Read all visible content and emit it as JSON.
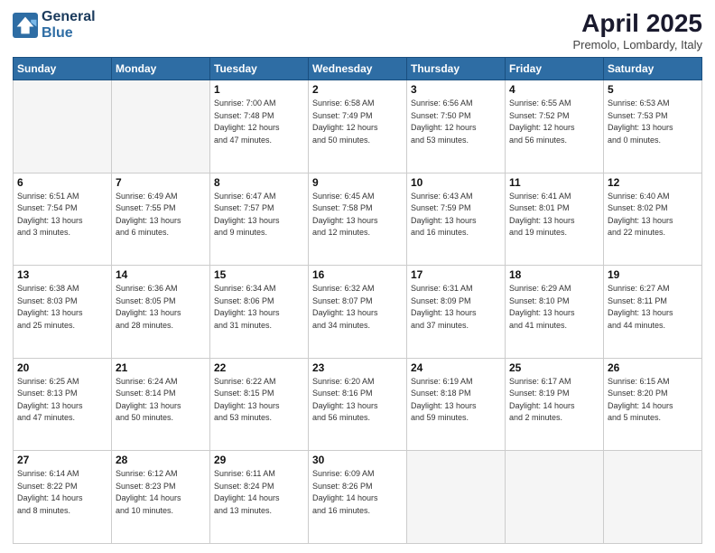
{
  "header": {
    "logo_line1": "General",
    "logo_line2": "Blue",
    "month_title": "April 2025",
    "subtitle": "Premolo, Lombardy, Italy"
  },
  "weekdays": [
    "Sunday",
    "Monday",
    "Tuesday",
    "Wednesday",
    "Thursday",
    "Friday",
    "Saturday"
  ],
  "weeks": [
    [
      {
        "day": "",
        "info": ""
      },
      {
        "day": "",
        "info": ""
      },
      {
        "day": "1",
        "info": "Sunrise: 7:00 AM\nSunset: 7:48 PM\nDaylight: 12 hours\nand 47 minutes."
      },
      {
        "day": "2",
        "info": "Sunrise: 6:58 AM\nSunset: 7:49 PM\nDaylight: 12 hours\nand 50 minutes."
      },
      {
        "day": "3",
        "info": "Sunrise: 6:56 AM\nSunset: 7:50 PM\nDaylight: 12 hours\nand 53 minutes."
      },
      {
        "day": "4",
        "info": "Sunrise: 6:55 AM\nSunset: 7:52 PM\nDaylight: 12 hours\nand 56 minutes."
      },
      {
        "day": "5",
        "info": "Sunrise: 6:53 AM\nSunset: 7:53 PM\nDaylight: 13 hours\nand 0 minutes."
      }
    ],
    [
      {
        "day": "6",
        "info": "Sunrise: 6:51 AM\nSunset: 7:54 PM\nDaylight: 13 hours\nand 3 minutes."
      },
      {
        "day": "7",
        "info": "Sunrise: 6:49 AM\nSunset: 7:55 PM\nDaylight: 13 hours\nand 6 minutes."
      },
      {
        "day": "8",
        "info": "Sunrise: 6:47 AM\nSunset: 7:57 PM\nDaylight: 13 hours\nand 9 minutes."
      },
      {
        "day": "9",
        "info": "Sunrise: 6:45 AM\nSunset: 7:58 PM\nDaylight: 13 hours\nand 12 minutes."
      },
      {
        "day": "10",
        "info": "Sunrise: 6:43 AM\nSunset: 7:59 PM\nDaylight: 13 hours\nand 16 minutes."
      },
      {
        "day": "11",
        "info": "Sunrise: 6:41 AM\nSunset: 8:01 PM\nDaylight: 13 hours\nand 19 minutes."
      },
      {
        "day": "12",
        "info": "Sunrise: 6:40 AM\nSunset: 8:02 PM\nDaylight: 13 hours\nand 22 minutes."
      }
    ],
    [
      {
        "day": "13",
        "info": "Sunrise: 6:38 AM\nSunset: 8:03 PM\nDaylight: 13 hours\nand 25 minutes."
      },
      {
        "day": "14",
        "info": "Sunrise: 6:36 AM\nSunset: 8:05 PM\nDaylight: 13 hours\nand 28 minutes."
      },
      {
        "day": "15",
        "info": "Sunrise: 6:34 AM\nSunset: 8:06 PM\nDaylight: 13 hours\nand 31 minutes."
      },
      {
        "day": "16",
        "info": "Sunrise: 6:32 AM\nSunset: 8:07 PM\nDaylight: 13 hours\nand 34 minutes."
      },
      {
        "day": "17",
        "info": "Sunrise: 6:31 AM\nSunset: 8:09 PM\nDaylight: 13 hours\nand 37 minutes."
      },
      {
        "day": "18",
        "info": "Sunrise: 6:29 AM\nSunset: 8:10 PM\nDaylight: 13 hours\nand 41 minutes."
      },
      {
        "day": "19",
        "info": "Sunrise: 6:27 AM\nSunset: 8:11 PM\nDaylight: 13 hours\nand 44 minutes."
      }
    ],
    [
      {
        "day": "20",
        "info": "Sunrise: 6:25 AM\nSunset: 8:13 PM\nDaylight: 13 hours\nand 47 minutes."
      },
      {
        "day": "21",
        "info": "Sunrise: 6:24 AM\nSunset: 8:14 PM\nDaylight: 13 hours\nand 50 minutes."
      },
      {
        "day": "22",
        "info": "Sunrise: 6:22 AM\nSunset: 8:15 PM\nDaylight: 13 hours\nand 53 minutes."
      },
      {
        "day": "23",
        "info": "Sunrise: 6:20 AM\nSunset: 8:16 PM\nDaylight: 13 hours\nand 56 minutes."
      },
      {
        "day": "24",
        "info": "Sunrise: 6:19 AM\nSunset: 8:18 PM\nDaylight: 13 hours\nand 59 minutes."
      },
      {
        "day": "25",
        "info": "Sunrise: 6:17 AM\nSunset: 8:19 PM\nDaylight: 14 hours\nand 2 minutes."
      },
      {
        "day": "26",
        "info": "Sunrise: 6:15 AM\nSunset: 8:20 PM\nDaylight: 14 hours\nand 5 minutes."
      }
    ],
    [
      {
        "day": "27",
        "info": "Sunrise: 6:14 AM\nSunset: 8:22 PM\nDaylight: 14 hours\nand 8 minutes."
      },
      {
        "day": "28",
        "info": "Sunrise: 6:12 AM\nSunset: 8:23 PM\nDaylight: 14 hours\nand 10 minutes."
      },
      {
        "day": "29",
        "info": "Sunrise: 6:11 AM\nSunset: 8:24 PM\nDaylight: 14 hours\nand 13 minutes."
      },
      {
        "day": "30",
        "info": "Sunrise: 6:09 AM\nSunset: 8:26 PM\nDaylight: 14 hours\nand 16 minutes."
      },
      {
        "day": "",
        "info": ""
      },
      {
        "day": "",
        "info": ""
      },
      {
        "day": "",
        "info": ""
      }
    ]
  ]
}
